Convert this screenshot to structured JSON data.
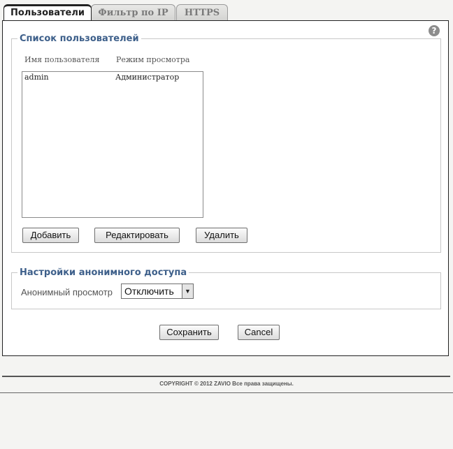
{
  "tabs": [
    {
      "label": "Пользователи",
      "active": true
    },
    {
      "label": "Фильтр по IP",
      "active": false
    },
    {
      "label": "HTTPS",
      "active": false
    }
  ],
  "help_icon": "question-mark-icon",
  "users_section": {
    "title": "Список пользователей",
    "columns": [
      "Имя пользователя",
      "Режим просмотра"
    ],
    "rows": [
      {
        "name": "admin",
        "mode": "Администратор"
      }
    ],
    "buttons": {
      "add": "Добавить",
      "edit": "Редактировать",
      "delete": "Удалить"
    }
  },
  "anon_section": {
    "title": "Настройки анонимного доступа",
    "label": "Анонимный просмотр",
    "select_value": "Отключить"
  },
  "actions": {
    "save": "Сохранить",
    "cancel": "Cancel"
  },
  "footer": {
    "copyright": "COPYRIGHT © 2012 ZAVIO Все права защищены."
  },
  "colors": {
    "legend": "#3d5f8a",
    "background": "#f4f4f2"
  }
}
